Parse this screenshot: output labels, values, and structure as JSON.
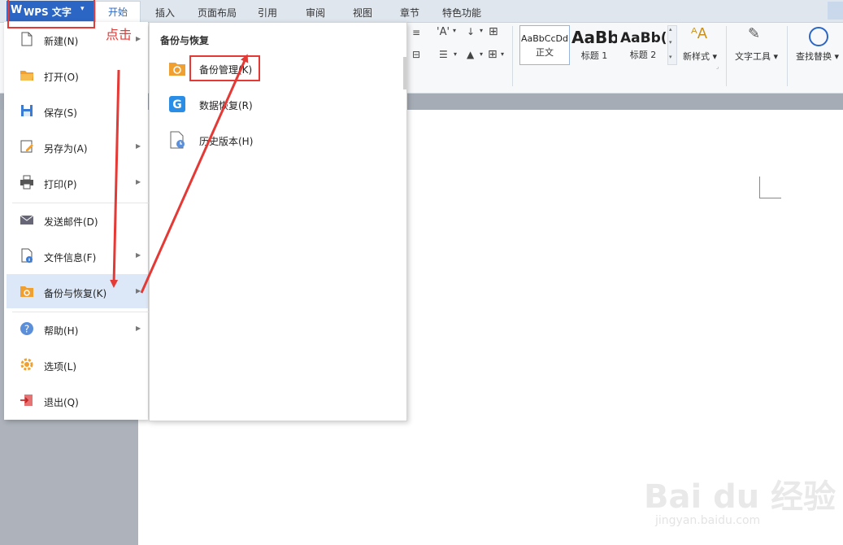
{
  "app": {
    "name": "WPS 文字",
    "logo": "W",
    "caret": "▾"
  },
  "tabs": [
    "开始",
    "插入",
    "页面布局",
    "引用",
    "审阅",
    "视图",
    "章节",
    "特色功能"
  ],
  "active_tab": "开始",
  "ribbon": {
    "styles": [
      {
        "sample": "AaBbCcDd",
        "label": "正文"
      },
      {
        "sample": "AaBb",
        "label": "标题 1"
      },
      {
        "sample": "AaBb(",
        "label": "标题 2"
      }
    ],
    "new_style": "新样式",
    "text_tools": "文字工具",
    "find_replace": "查找替换",
    "dropdown_caret": "▾"
  },
  "annotation_text": "点击",
  "file_menu": {
    "items": [
      {
        "label": "新建(N)",
        "icon": "new-document-icon",
        "submenu": true
      },
      {
        "label": "打开(O)",
        "icon": "open-folder-icon",
        "submenu": false
      },
      {
        "label": "保存(S)",
        "icon": "save-icon",
        "submenu": false
      },
      {
        "label": "另存为(A)",
        "icon": "save-as-icon",
        "submenu": true
      },
      {
        "label": "打印(P)",
        "icon": "print-icon",
        "submenu": true
      },
      {
        "label": "发送邮件(D)",
        "icon": "mail-icon",
        "submenu": false
      },
      {
        "label": "文件信息(F)",
        "icon": "file-info-icon",
        "submenu": true
      },
      {
        "label": "备份与恢复(K)",
        "icon": "backup-icon",
        "submenu": true,
        "selected": true
      },
      {
        "label": "帮助(H)",
        "icon": "help-icon",
        "submenu": true
      },
      {
        "label": "选项(L)",
        "icon": "options-gear-icon",
        "submenu": false
      },
      {
        "label": "退出(Q)",
        "icon": "exit-icon",
        "submenu": false
      }
    ],
    "arrow": "▶"
  },
  "submenu": {
    "title": "备份与恢复",
    "items": [
      {
        "label": "备份管理(K)",
        "icon": "backup-manage-icon"
      },
      {
        "label": "数据恢复(R)",
        "icon": "data-recovery-icon"
      },
      {
        "label": "历史版本(H)",
        "icon": "history-version-icon"
      }
    ]
  },
  "watermark": {
    "brand": "Bai du 经验",
    "url": "jingyan.baidu.com"
  },
  "colors": {
    "accent": "#2b66c4",
    "annotation": "#e53935",
    "selected": "#dce8f7",
    "workspace": "#aeb3bb"
  }
}
